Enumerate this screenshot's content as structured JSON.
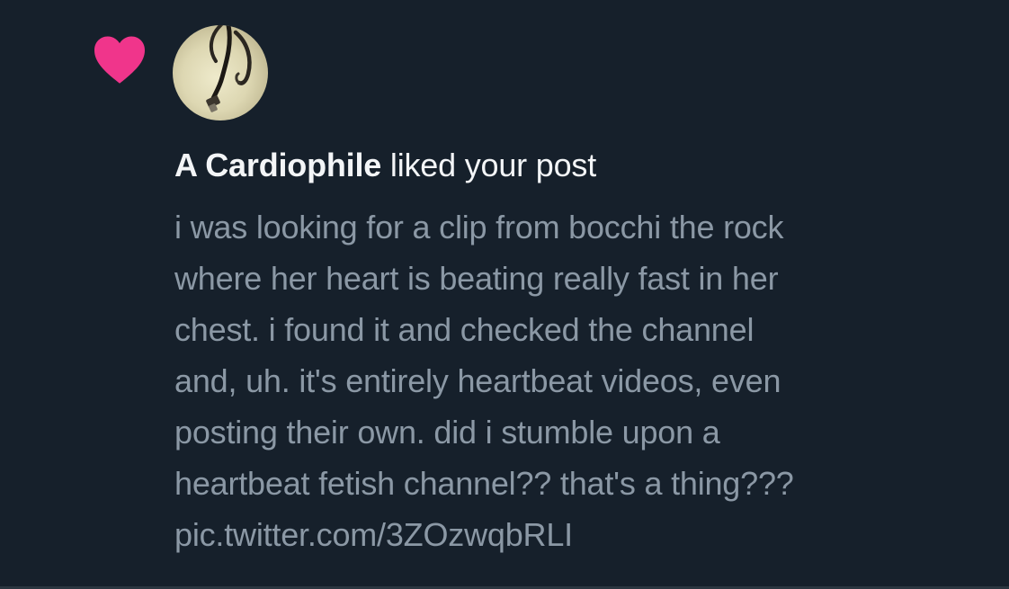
{
  "notification": {
    "icon": "heart-icon",
    "icon_color": "#f0358b",
    "avatar": "stethoscope-avatar",
    "user_name": "A Cardiophile",
    "action_text": " liked your post",
    "post_lines": [
      "i was looking for a clip from bocchi the rock",
      "where her heart is beating really fast in her",
      "chest. i found it and checked the channel",
      "and, uh. it's entirely heartbeat videos, even",
      "posting their own. did i stumble upon a",
      "heartbeat fetish channel?? that's a thing???",
      "pic.twitter.com/3ZOzwqbRLI"
    ]
  },
  "colors": {
    "background": "#16202b",
    "primary_text": "#f3f5f7",
    "secondary_text": "#8b98a5",
    "heart": "#f0358b"
  }
}
